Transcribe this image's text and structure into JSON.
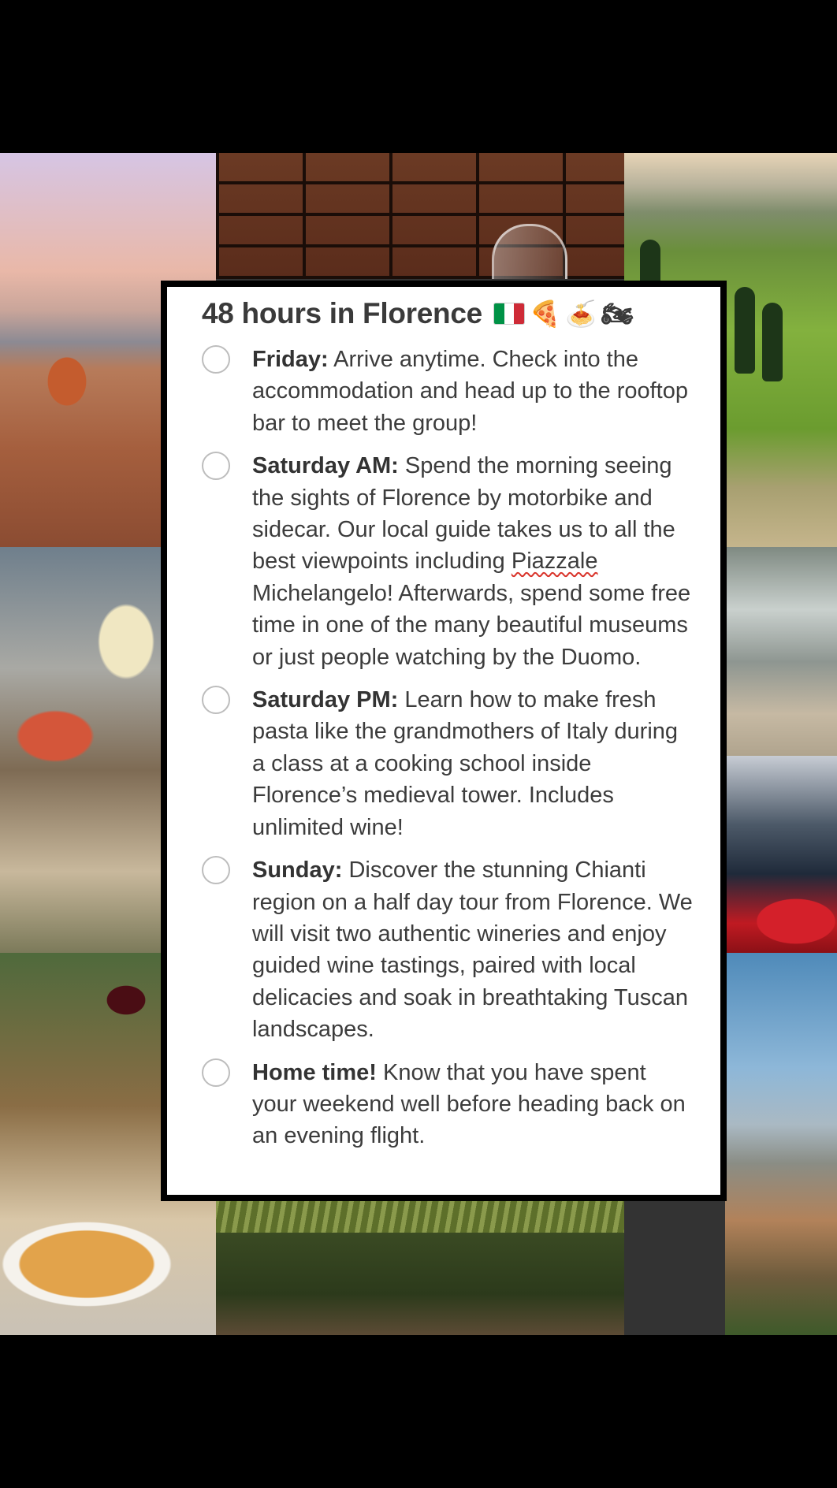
{
  "title": "48 hours in Florence",
  "title_icons": [
    "italy-flag-icon",
    "pizza-icon",
    "spaghetti-icon",
    "motorcycle-icon"
  ],
  "title_emojis": {
    "pizza": "🍕",
    "spaghetti": "🍝",
    "motorcycle": "🏍"
  },
  "colors": {
    "flag_green": "#009246",
    "flag_white": "#ffffff",
    "flag_red": "#ce2b37",
    "checkbox_border": "#bdbdbd",
    "spellcheck_underline": "#d9342b"
  },
  "items": [
    {
      "label": "Friday:",
      "text": " Arrive anytime. Check into the accommodation and head up to the rooftop bar to meet the group!",
      "checked": false
    },
    {
      "label": "Saturday AM:",
      "text_before": " Spend the morning seeing the sights of Florence by motorbike and sidecar. Our local guide takes us to all the best viewpoints including ",
      "spell_word": "Piazzale",
      "text_after": " Michelangelo! Afterwards, spend some free time in one of the many beautiful museums or just people watching by the Duomo.",
      "checked": false
    },
    {
      "label": "Saturday PM:",
      "text": " Learn how to make fresh pasta like the grandmothers of Italy during a class at a cooking school inside Florence’s medieval tower. Includes unlimited wine!",
      "checked": false
    },
    {
      "label": "Sunday:",
      "text": " Discover the stunning Chianti region on a half day tour from Florence. We will visit two authentic wineries and enjoy guided wine tastings, paired with local delicacies and soak in breathtaking Tuscan landscapes.",
      "checked": false
    },
    {
      "label": "Home time!",
      "text": " Know that you have spent your weekend well before heading back on an evening flight.",
      "checked": false
    }
  ]
}
